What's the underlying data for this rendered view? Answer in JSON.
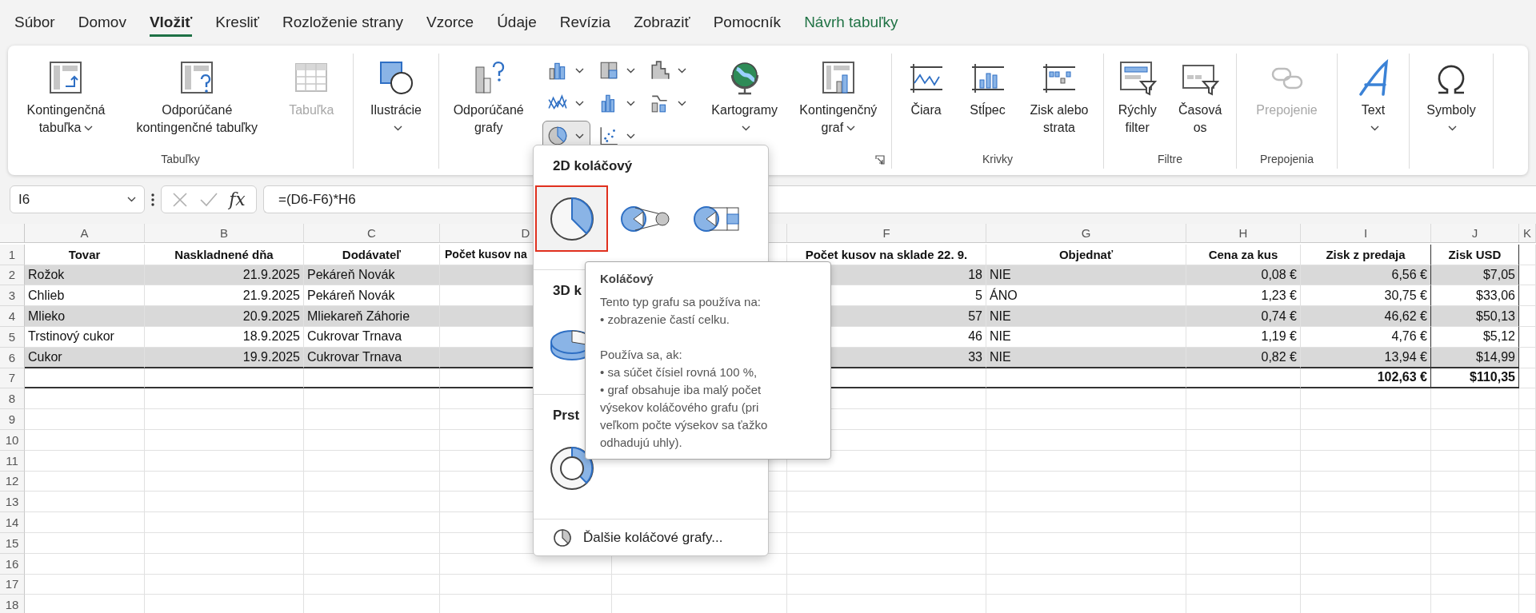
{
  "tabs": [
    {
      "label": "Súbor",
      "selected": false,
      "contextual": false
    },
    {
      "label": "Domov",
      "selected": false,
      "contextual": false
    },
    {
      "label": "Vložiť",
      "selected": true,
      "contextual": false
    },
    {
      "label": "Kresliť",
      "selected": false,
      "contextual": false
    },
    {
      "label": "Rozloženie strany",
      "selected": false,
      "contextual": false
    },
    {
      "label": "Vzorce",
      "selected": false,
      "contextual": false
    },
    {
      "label": "Údaje",
      "selected": false,
      "contextual": false
    },
    {
      "label": "Revízia",
      "selected": false,
      "contextual": false
    },
    {
      "label": "Zobraziť",
      "selected": false,
      "contextual": false
    },
    {
      "label": "Pomocník",
      "selected": false,
      "contextual": false
    },
    {
      "label": "Návrh tabuľky",
      "selected": false,
      "contextual": true
    }
  ],
  "ribbon": {
    "groups": [
      {
        "label": "Tabuľky",
        "items": [
          {
            "kind": "large",
            "label": "Kontingenčná\ntabuľka",
            "has_menu": true,
            "disabled": false
          },
          {
            "kind": "large",
            "label": "Odporúčané\nkontingenčné tabuľky",
            "has_menu": false,
            "disabled": false
          },
          {
            "kind": "large",
            "label": "Tabuľka",
            "has_menu": false,
            "disabled": true
          }
        ]
      },
      {
        "items": [
          {
            "kind": "large",
            "label": "Ilustrácie",
            "has_menu": true,
            "disabled": false
          }
        ]
      },
      {
        "launcher": true,
        "items": [
          {
            "kind": "large",
            "label": "Odporúčané\ngrafy",
            "has_menu": false,
            "disabled": false
          },
          {
            "kind": "grid",
            "buttons": [
              {
                "pressed": false
              },
              {
                "pressed": false
              },
              {
                "pressed": false
              },
              {
                "pressed": false
              },
              {
                "pressed": false
              },
              {
                "pressed": false
              },
              {
                "pressed": true
              },
              {
                "pressed": false
              }
            ]
          },
          {
            "kind": "large",
            "label": "Kartogramy",
            "has_menu": true,
            "disabled": false
          },
          {
            "kind": "large",
            "label": "Kontingenčný\ngraf",
            "has_menu": true,
            "disabled": false
          }
        ]
      },
      {
        "label": "Krivky",
        "items": [
          {
            "kind": "large",
            "label": "Čiara",
            "has_menu": false,
            "disabled": false
          },
          {
            "kind": "large",
            "label": "Stĺpec",
            "has_menu": false,
            "disabled": false
          },
          {
            "kind": "large",
            "label": "Zisk alebo\nstrata",
            "has_menu": false,
            "disabled": false
          }
        ]
      },
      {
        "label": "Filtre",
        "items": [
          {
            "kind": "large",
            "label": "Rýchly\nfilter",
            "has_menu": false,
            "disabled": false
          },
          {
            "kind": "large",
            "label": "Časová\nos",
            "has_menu": false,
            "disabled": false
          }
        ]
      },
      {
        "label": "Prepojenia",
        "items": [
          {
            "kind": "large",
            "label": "Prepojenie",
            "has_menu": false,
            "disabled": true
          }
        ]
      },
      {
        "items": [
          {
            "kind": "large",
            "label": "Text",
            "has_menu": true,
            "disabled": false
          }
        ]
      },
      {
        "items": [
          {
            "kind": "large",
            "label": "Symboly",
            "has_menu": true,
            "disabled": false
          }
        ]
      }
    ]
  },
  "formula_bar": {
    "name_box": "I6",
    "function_label": "fx",
    "formula": "=(D6-F6)*H6"
  },
  "sheet": {
    "columns": [
      {
        "letter": "A"
      },
      {
        "letter": "B"
      },
      {
        "letter": "C"
      },
      {
        "letter": "D"
      },
      {},
      {
        "letter": "F"
      },
      {
        "letter": "G"
      },
      {
        "letter": "H"
      },
      {
        "letter": "I"
      },
      {
        "letter": "J"
      },
      {
        "letter": "K"
      }
    ],
    "rows": [
      {
        "number": "1",
        "kind": "header",
        "cells": {
          "A": "Tovar",
          "B": "Naskladnené dňa",
          "C": "Dodávateľ",
          "D": "Počet kusov na",
          "F": "Počet kusov na sklade 22. 9.",
          "G": "Objednať",
          "H": "Cena za kus",
          "I": "Zisk z predaja",
          "J": "Zisk USD"
        }
      },
      {
        "number": "2",
        "kind": "data",
        "shaded": true,
        "cells": {
          "A": "Rožok",
          "B": "21.9.2025",
          "C": "Pekáreň Novák",
          "F": "18",
          "G": "NIE",
          "H": "0,08 €",
          "I": "6,56 €",
          "J": "$7,05"
        }
      },
      {
        "number": "3",
        "kind": "data",
        "shaded": false,
        "cells": {
          "A": "Chlieb",
          "B": "21.9.2025",
          "C": "Pekáreň Novák",
          "F": "5",
          "G": "ÁNO",
          "H": "1,23 €",
          "I": "30,75 €",
          "J": "$33,06"
        }
      },
      {
        "number": "4",
        "kind": "data",
        "shaded": true,
        "cells": {
          "A": "Mlieko",
          "B": "20.9.2025",
          "C": "Mliekareň Záhorie",
          "F": "57",
          "G": "NIE",
          "H": "0,74 €",
          "I": "46,62 €",
          "J": "$50,13"
        }
      },
      {
        "number": "5",
        "kind": "data",
        "shaded": false,
        "cells": {
          "A": "Trstinový cukor",
          "B": "18.9.2025",
          "C": "Cukrovar Trnava",
          "F": "46",
          "G": "NIE",
          "H": "1,19 €",
          "I": "4,76 €",
          "J": "$5,12"
        }
      },
      {
        "number": "6",
        "kind": "data",
        "shaded": true,
        "cells": {
          "A": "Cukor",
          "B": "19.9.2025",
          "C": "Cukrovar Trnava",
          "F": "33",
          "G": "NIE",
          "H": "0,82 €",
          "I": "13,94 €",
          "J": "$14,99"
        }
      },
      {
        "number": "7",
        "kind": "total",
        "cells": {
          "I": "102,63 €",
          "J": "$110,35"
        }
      },
      {
        "number": "8",
        "kind": "empty"
      },
      {
        "number": "9",
        "kind": "empty"
      },
      {
        "number": "10",
        "kind": "empty"
      },
      {
        "number": "11",
        "kind": "empty"
      },
      {
        "number": "12",
        "kind": "empty"
      },
      {
        "number": "13",
        "kind": "empty"
      },
      {
        "number": "14",
        "kind": "empty"
      },
      {
        "number": "15",
        "kind": "empty"
      },
      {
        "number": "16",
        "kind": "empty"
      },
      {
        "number": "17",
        "kind": "empty"
      },
      {
        "number": "18",
        "kind": "empty"
      }
    ]
  },
  "chart_menu": {
    "sections": [
      {
        "heading": "2D koláčový",
        "options": [
          {
            "selected": true
          },
          {
            "selected": false
          },
          {
            "selected": false
          }
        ]
      },
      {
        "heading": "3D k",
        "options": [
          {
            "selected": false
          }
        ]
      },
      {
        "heading": "Prst",
        "options": [
          {
            "selected": false
          }
        ]
      }
    ],
    "footer": "Ďalšie koláčové grafy..."
  },
  "tooltip": {
    "title": "Koláčový",
    "paragraphs": [
      "Tento typ grafu sa používa na:\n• zobrazenie častí celku.",
      "Používa sa, ak:\n• sa súčet čísiel rovná 100 %,\n• graf obsahuje iba malý počet\nvýsekov koláčového grafu (pri\nveľkom počte výsekov sa ťažko\nodhadujú uhly)."
    ]
  }
}
